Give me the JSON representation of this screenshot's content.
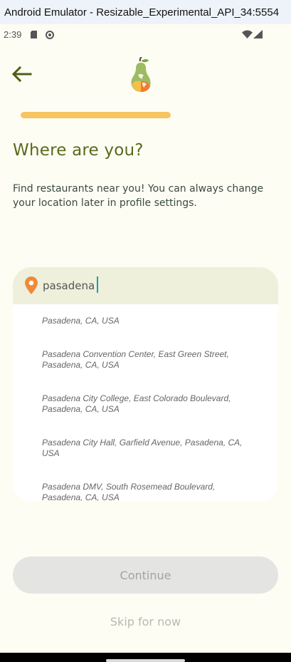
{
  "window": {
    "title": "Android Emulator - Resizable_Experimental_API_34:5554"
  },
  "status_bar": {
    "time": "2:39"
  },
  "progress": {
    "fraction": 1.0
  },
  "page": {
    "title": "Where are you?",
    "subtitle": "Find restaurants near you! You can always change your location later in profile settings."
  },
  "search": {
    "value": "pasadena",
    "placeholder": ""
  },
  "suggestions": [
    "Pasadena, CA, USA",
    "Pasadena Convention Center, East Green Street, Pasadena, CA, USA",
    "Pasadena City College, East Colorado Boulevard, Pasadena, CA, USA",
    "Pasadena City Hall, Garfield Avenue, Pasadena, CA, USA",
    "Pasadena DMV, South Rosemead Boulevard, Pasadena, CA, USA"
  ],
  "actions": {
    "continue_label": "Continue",
    "skip_label": "Skip for now"
  },
  "colors": {
    "accent_green": "#5a6a1a",
    "progress_yellow": "#f7c462",
    "pin_orange": "#ef8a3a",
    "background": "#fdfdf4"
  }
}
